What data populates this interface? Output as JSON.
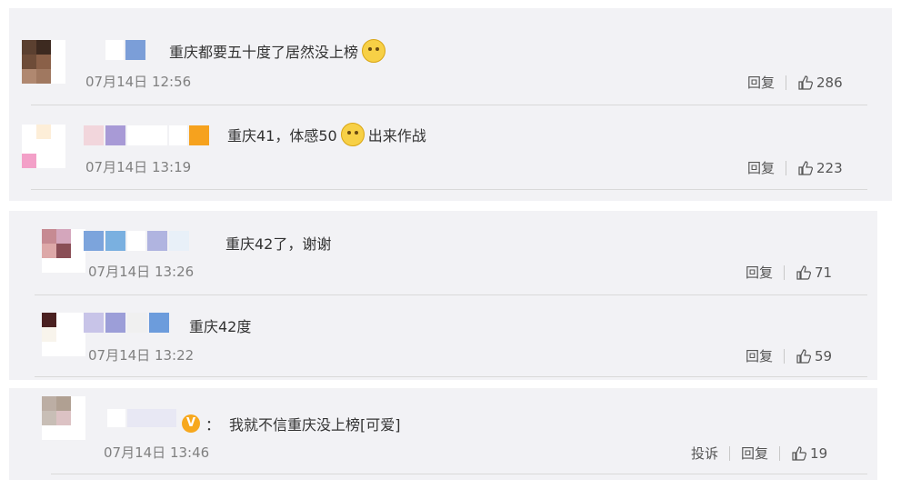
{
  "comments": [
    {
      "text": "重庆都要五十度了居然没上榜",
      "emoji": "sleepy-face-emoji",
      "time": "07月14日 12:56",
      "reply": "回复",
      "likes": "286"
    },
    {
      "text_before": "重庆41，体感50",
      "emoji": "cat-face-emoji",
      "text_after": "出来作战",
      "time": "07月14日 13:19",
      "reply": "回复",
      "likes": "223"
    },
    {
      "text": "重庆42了，谢谢",
      "time": "07月14日 13:26",
      "reply": "回复",
      "likes": "71"
    },
    {
      "text": "重庆42度",
      "time": "07月14日 13:22",
      "reply": "回复",
      "likes": "59"
    },
    {
      "badge": "V",
      "colon": "：",
      "text": "我就不信重庆没上榜[可爱]",
      "time": "07月14日 13:46",
      "report": "投诉",
      "reply": "回复",
      "likes": "19"
    }
  ],
  "colors": {
    "card_bg": "#f2f2f5",
    "time": "#808080",
    "badge": "#f7a81e"
  }
}
